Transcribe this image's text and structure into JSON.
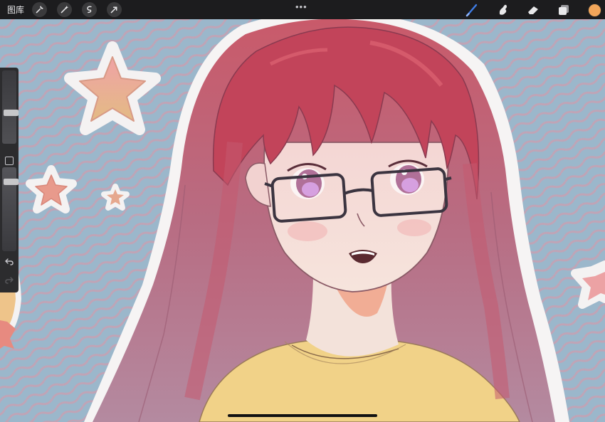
{
  "toolbar": {
    "gallery_label": "图库",
    "left_tools": [
      "wrench-icon",
      "magic-wand-icon",
      "selection-icon",
      "transform-arrow-icon"
    ],
    "more_menu": "•••",
    "right_tools": [
      "brush-icon",
      "smudge-icon",
      "eraser-icon",
      "layers-icon"
    ],
    "active_tool": "brush-icon",
    "current_color": "#f2a65a"
  },
  "sidebar": {
    "controls": [
      "brush-size-slider",
      "modify-button",
      "opacity-slider",
      "undo-icon",
      "redo-icon"
    ]
  },
  "colors": {
    "toolbar_bg": "#1c1c1e",
    "accent_blue": "#3f7ee8",
    "canvas_bg": "#95b4c9"
  }
}
